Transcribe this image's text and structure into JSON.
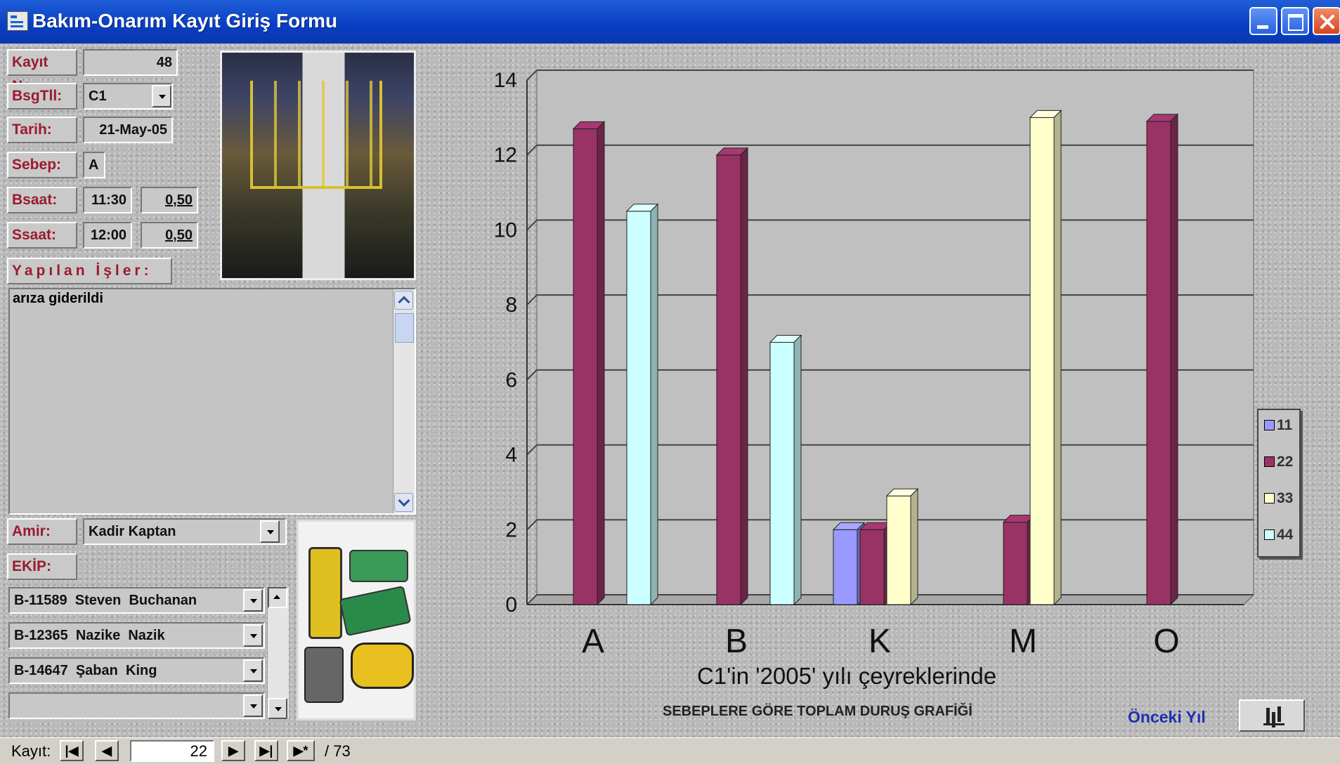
{
  "window": {
    "title": "Bakım-Onarım Kayıt Giriş Formu"
  },
  "form": {
    "kayit_no": {
      "label": "Kayıt No:",
      "value": "48"
    },
    "bsgtll": {
      "label": "BsgTll:",
      "value": "C1"
    },
    "tarih": {
      "label": "Tarih:",
      "value": "21-May-05"
    },
    "sebep": {
      "label": "Sebep:",
      "value": "A"
    },
    "bsaat": {
      "label": "Bsaat:",
      "time": "11:30",
      "duration": "0,50"
    },
    "ssaat": {
      "label": "Ssaat:",
      "time": "12:00",
      "duration": "0,50"
    },
    "yapilan": {
      "label": "Yapılan İşler:",
      "text": "arıza giderildi"
    },
    "amir": {
      "label": "Amir:",
      "value": "Kadir Kaptan"
    },
    "ekip": {
      "label": "EKİP:",
      "rows": [
        {
          "id": "B-11589",
          "name": "Steven",
          "surname": "Buchanan"
        },
        {
          "id": "B-12365",
          "name": "Nazike",
          "surname": "Nazik"
        },
        {
          "id": "B-14647",
          "name": "Şaban",
          "surname": "King"
        },
        {
          "id": "",
          "name": "",
          "surname": ""
        }
      ]
    }
  },
  "chart_data": {
    "type": "bar",
    "categories": [
      "A",
      "B",
      "K",
      "M",
      "O"
    ],
    "series": [
      {
        "name": "11",
        "color": "#9999ff",
        "values": [
          null,
          null,
          2,
          null,
          null
        ]
      },
      {
        "name": "22",
        "color": "#993366",
        "values": [
          12.7,
          12,
          2,
          2.2,
          12.9
        ]
      },
      {
        "name": "33",
        "color": "#ffffcc",
        "values": [
          null,
          null,
          2.9,
          13,
          null
        ]
      },
      {
        "name": "44",
        "color": "#ccffff",
        "values": [
          10.5,
          7,
          null,
          null,
          null
        ]
      }
    ],
    "ylim": [
      0,
      14
    ],
    "yticks": [
      "0",
      "2",
      "4",
      "6",
      "8",
      "10",
      "12",
      "14"
    ],
    "title": "C1'in '2005' yılı çeyreklerinde",
    "subtitle": "SEBEPLERE GÖRE TOPLAM DURUŞ GRAFİĞİ",
    "legend": "right",
    "grid": true
  },
  "buttons": {
    "onceki_yil": "Önceki Yıl"
  },
  "nav": {
    "label": "Kayıt:",
    "current": "22",
    "total": "/ 73",
    "first": "|◀",
    "prev": "◀",
    "next": "▶",
    "last": "▶|",
    "new": "▶*"
  }
}
